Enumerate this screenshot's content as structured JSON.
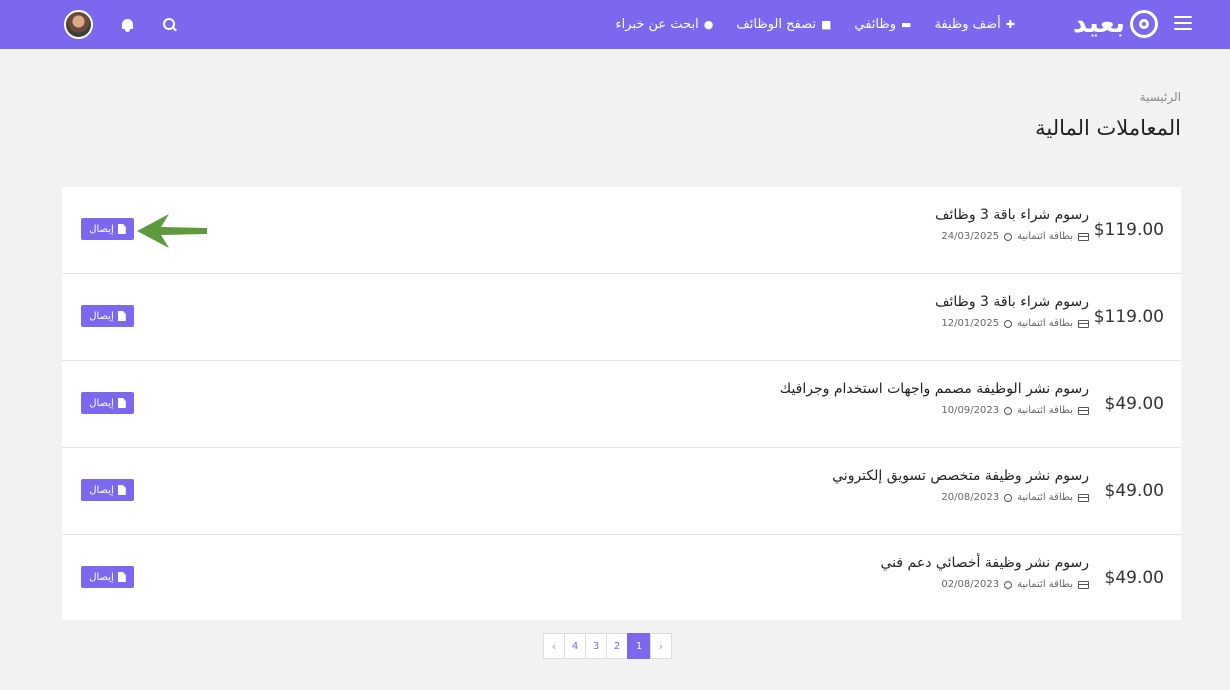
{
  "brand": {
    "name": "بعيد"
  },
  "nav": [
    {
      "label": "أضف وظيفة",
      "icon": "plus-icon"
    },
    {
      "label": "وظائفي",
      "icon": "folder-icon"
    },
    {
      "label": "تصفح الوظائف",
      "icon": "briefcase-icon"
    },
    {
      "label": "ابحث عن خبراء",
      "icon": "users-icon"
    }
  ],
  "breadcrumb": "الرئيسية",
  "page_title": "المعاملات المالية",
  "transactions": [
    {
      "amount": "$119.00",
      "title": "رسوم شراء باقة 3 وظائف",
      "payment_method": "بطاقة ائتمانية",
      "date": "24/03/2025",
      "receipt_label": "إيصال"
    },
    {
      "amount": "$119.00",
      "title": "رسوم شراء باقة 3 وظائف",
      "payment_method": "بطاقة ائتمانية",
      "date": "12/01/2025",
      "receipt_label": "إيصال"
    },
    {
      "amount": "$49.00",
      "title": "رسوم نشر الوظيفة مصمم واجهات استخدام وجرافيك",
      "payment_method": "بطاقة ائتمانية",
      "date": "10/09/2023",
      "receipt_label": "إيصال"
    },
    {
      "amount": "$49.00",
      "title": "رسوم نشر وظيفة متخصص تسويق إلكتروني",
      "payment_method": "بطاقة ائتمانية",
      "date": "20/08/2023",
      "receipt_label": "إيصال"
    },
    {
      "amount": "$49.00",
      "title": "رسوم نشر وظيفة أخصائي دعم فني",
      "payment_method": "بطاقة ائتمانية",
      "date": "02/08/2023",
      "receipt_label": "إيصال"
    }
  ],
  "pagination": {
    "prev": "‹",
    "next": "›",
    "pages": [
      "4",
      "3",
      "2",
      "1"
    ],
    "current": "1"
  },
  "colors": {
    "accent": "#7b68ee",
    "arrow": "#5e9a3c",
    "background": "#f2f2f2"
  }
}
